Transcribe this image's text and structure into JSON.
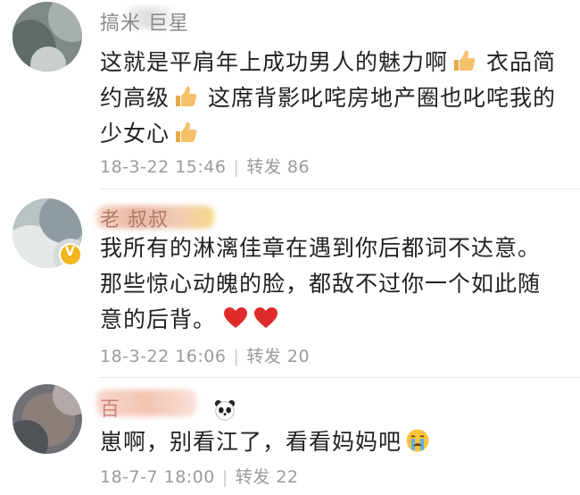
{
  "comments": [
    {
      "user": "搞米 巨星",
      "lines": [
        "这就是平肩年上成功男人的魅力啊",
        " 衣品简",
        "约高级",
        " 这席背影叱咤房地产圈也叱咤我的",
        "少女心"
      ],
      "date": "18-3-22 15:46",
      "repost_label": "转发",
      "repost_count": "86"
    },
    {
      "user": "老 叔叔",
      "lines": [
        "我所有的淋漓佳章在遇到你后都词不达意。",
        "那些惊心动魄的脸，都敌不过你一个如此随",
        "意的后背。"
      ],
      "date": "18-3-22 16:06",
      "repost_label": "转发",
      "repost_count": "20",
      "verified_icon": "v-badge-icon"
    },
    {
      "user": "百",
      "lines": [
        "崽啊，别看江了，看看妈妈吧"
      ],
      "date": "18-7-7 18:00",
      "repost_label": "转发",
      "repost_count": "22"
    }
  ],
  "icons": {
    "thumb": "thumbs-up-emoji",
    "heart": "heart-emoji",
    "cry": "crying-face-emoji",
    "panda": "panda-emoji"
  },
  "colors": {
    "meta": "#9b9b9b",
    "heart": "#e02b2b",
    "badge": "#f3b61b"
  }
}
